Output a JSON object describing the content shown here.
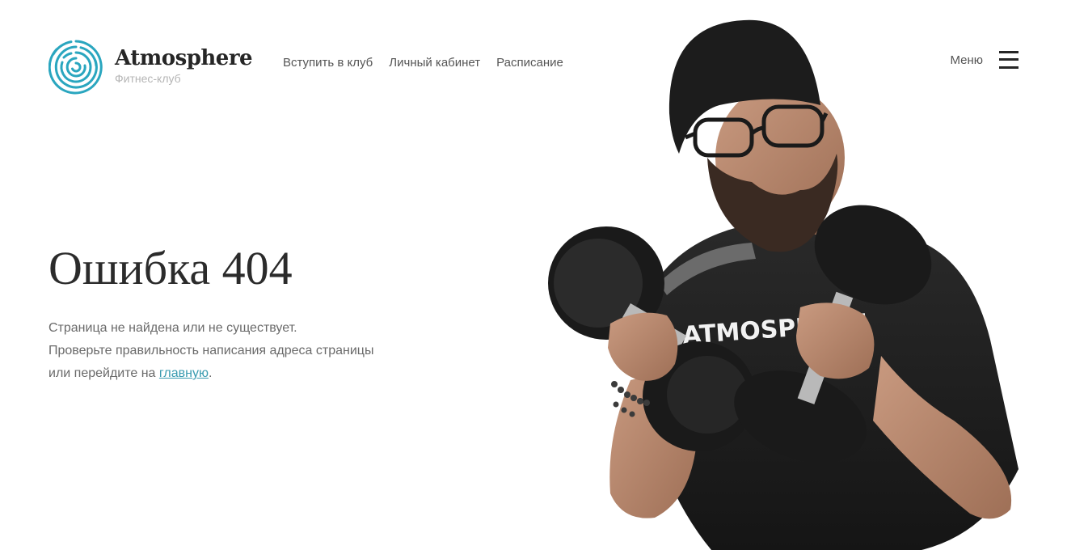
{
  "header": {
    "brand": "Atmosphere",
    "tagline": "Фитнес-клуб",
    "nav": [
      {
        "label": "Вступить в клуб"
      },
      {
        "label": "Личный кабинет"
      },
      {
        "label": "Расписание"
      }
    ],
    "menu_label": "Меню",
    "menu_icon": "hamburger-icon"
  },
  "main": {
    "title": "Ошибка 404",
    "line1": "Страница не найдена или не существует.",
    "line2": "Проверьте правильность написания адреса страницы",
    "line3_prefix": "или перейдите на ",
    "home_link": "главную",
    "line3_suffix": "."
  },
  "hero": {
    "shirt_text": "ATMOSPHERE",
    "image": "man-with-dumbbells"
  },
  "colors": {
    "accent": "#3a9bb0",
    "logo": "#2aa6bf",
    "text": "#2b2b2b",
    "muted": "#6a6a6a"
  }
}
